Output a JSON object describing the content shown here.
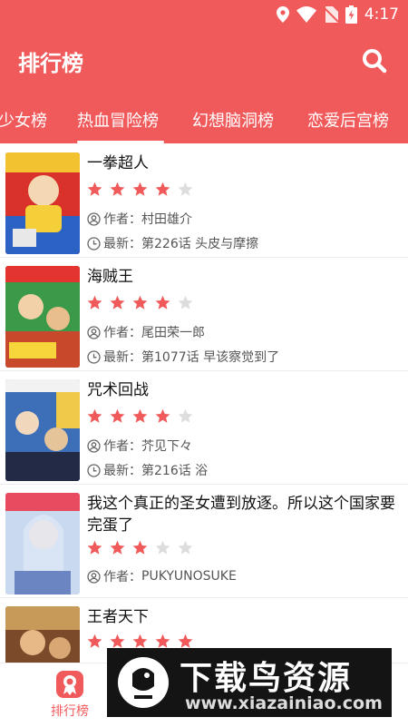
{
  "status": {
    "time": "4:17"
  },
  "app": {
    "title": "排行榜"
  },
  "tabs": [
    "少女榜",
    "热血冒险榜",
    "幻想脑洞榜",
    "恋爱后宫榜"
  ],
  "active_tab": 1,
  "labels": {
    "author_prefix": "作者：",
    "latest_prefix": "最新："
  },
  "comics": [
    {
      "title": "一拳超人",
      "rating": 4,
      "author": "村田雄介",
      "latest": "第226话 头皮与摩擦"
    },
    {
      "title": "海贼王",
      "rating": 4,
      "author": "尾田荣一郎",
      "latest": "第1077话 早该察觉到了"
    },
    {
      "title": "咒术回战",
      "rating": 4,
      "author": "芥见下々",
      "latest": "第216话 浴"
    },
    {
      "title": "我这个真正的圣女遭到放逐。所以这个国家要完蛋了",
      "rating": 3,
      "author": "PUKYUNOSUKE",
      "latest": ""
    },
    {
      "title": "王者天下",
      "rating": 5,
      "author": "",
      "latest": ""
    }
  ],
  "bottom_nav": {
    "rank_label": "排行榜"
  },
  "watermark": {
    "title": "下载鸟资源",
    "url": "www.xiazainiao.com"
  },
  "colors": {
    "brand": "#f05a5b",
    "star_on": "#f05a5b",
    "star_off": "#dddddd"
  }
}
